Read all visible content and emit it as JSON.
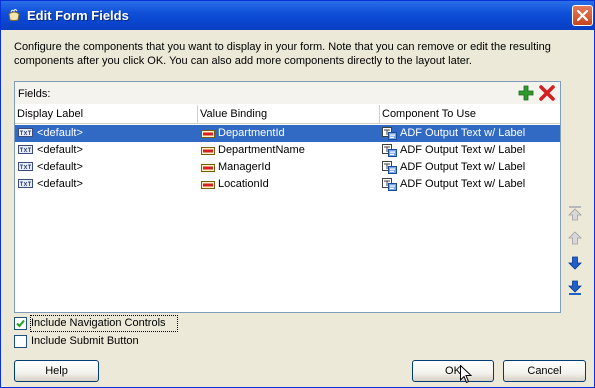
{
  "window": {
    "title": "Edit Form Fields",
    "title_icon": "oracle-jdeveloper-icon",
    "close_icon": "close-icon"
  },
  "description": "Configure the components that you want to display in your form.  Note that you can remove or edit the resulting components after you click OK.  You can also add more components directly to the layout later.",
  "fields": {
    "label": "Fields:",
    "add_icon": "add-icon",
    "delete_icon": "delete-icon",
    "columns": [
      "Display Label",
      "Value Binding",
      "Component To Use"
    ],
    "rows": [
      {
        "display_label": "<default>",
        "value_binding": "DepartmentId",
        "component": "ADF Output Text w/ Label",
        "selected": true
      },
      {
        "display_label": "<default>",
        "value_binding": "DepartmentName",
        "component": "ADF Output Text w/ Label",
        "selected": false
      },
      {
        "display_label": "<default>",
        "value_binding": "ManagerId",
        "component": "ADF Output Text w/ Label",
        "selected": false
      },
      {
        "display_label": "<default>",
        "value_binding": "LocationId",
        "component": "ADF Output Text w/ Label",
        "selected": false
      }
    ]
  },
  "move_buttons": [
    "move-top-icon",
    "move-up-icon",
    "move-down-icon",
    "move-bottom-icon"
  ],
  "options": {
    "include_navigation_controls": {
      "label": "Include Navigation Controls",
      "checked": true
    },
    "include_submit_button": {
      "label": "Include Submit Button",
      "checked": false
    }
  },
  "buttons": {
    "help": "Help",
    "ok": "OK",
    "cancel": "Cancel"
  },
  "colors": {
    "titlebar": "#0a46d0",
    "selection": "#316ac5",
    "add_green": "#2e9a2e",
    "delete_red": "#d42020",
    "move_blue": "#2060c8"
  }
}
